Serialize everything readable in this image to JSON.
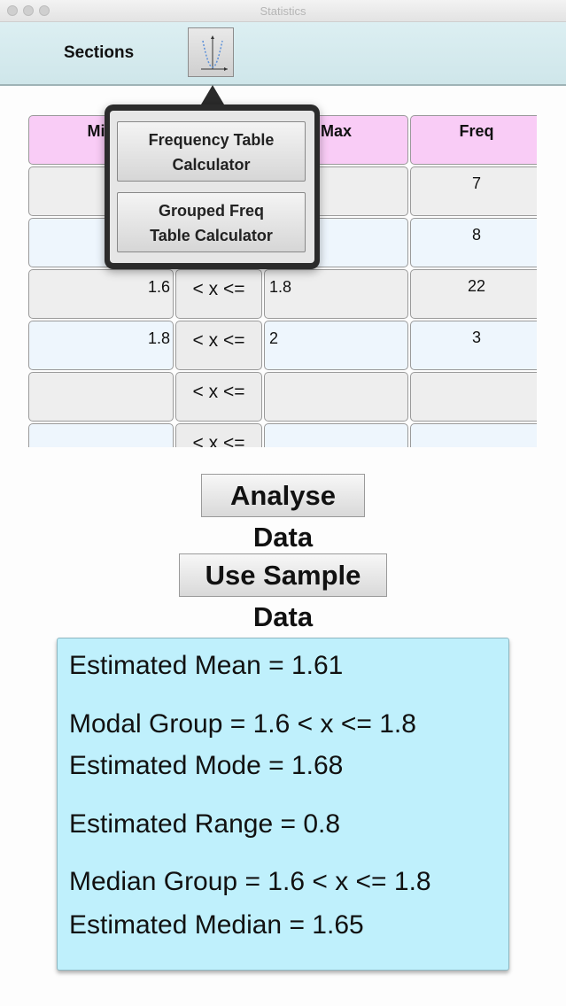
{
  "window": {
    "title": "Statistics"
  },
  "toolbar": {
    "sections_label": "Sections",
    "chart_icon": "distribution-chart-icon"
  },
  "table": {
    "headers": [
      "Min",
      "",
      "Max",
      "Freq"
    ],
    "rows": [
      {
        "min": "",
        "op": "",
        "max": "",
        "freq": "7"
      },
      {
        "min": "",
        "op": "",
        "max": "",
        "freq": "8"
      },
      {
        "min": "1.6",
        "op": "< x <=",
        "max": "1.8",
        "freq": "22"
      },
      {
        "min": "1.8",
        "op": "< x <=",
        "max": "2",
        "freq": "3"
      },
      {
        "min": "",
        "op": "< x <=",
        "max": "",
        "freq": ""
      },
      {
        "min": "",
        "op": "< x <=",
        "max": "",
        "freq": ""
      }
    ]
  },
  "popover": {
    "items": [
      {
        "label_line1": "Frequency Table",
        "label_line2": "Calculator"
      },
      {
        "label_line1": "Grouped Freq",
        "label_line2": "Table Calculator"
      }
    ]
  },
  "buttons": {
    "analyse": "Analyse Data",
    "sample": "Use Sample Data"
  },
  "results": {
    "mean": "Estimated Mean = 1.61",
    "modal_group": "Modal Group = 1.6 < x <= 1.8",
    "mode": "Estimated Mode = 1.68",
    "range": "Estimated Range = 0.8",
    "median_group": "Median Group = 1.6 < x <= 1.8",
    "median": "Estimated Median = 1.65"
  },
  "colors": {
    "header_bg": "#f9ccf6",
    "results_bg": "#bff0fc",
    "toolbar_bg": "#d6eaee"
  }
}
